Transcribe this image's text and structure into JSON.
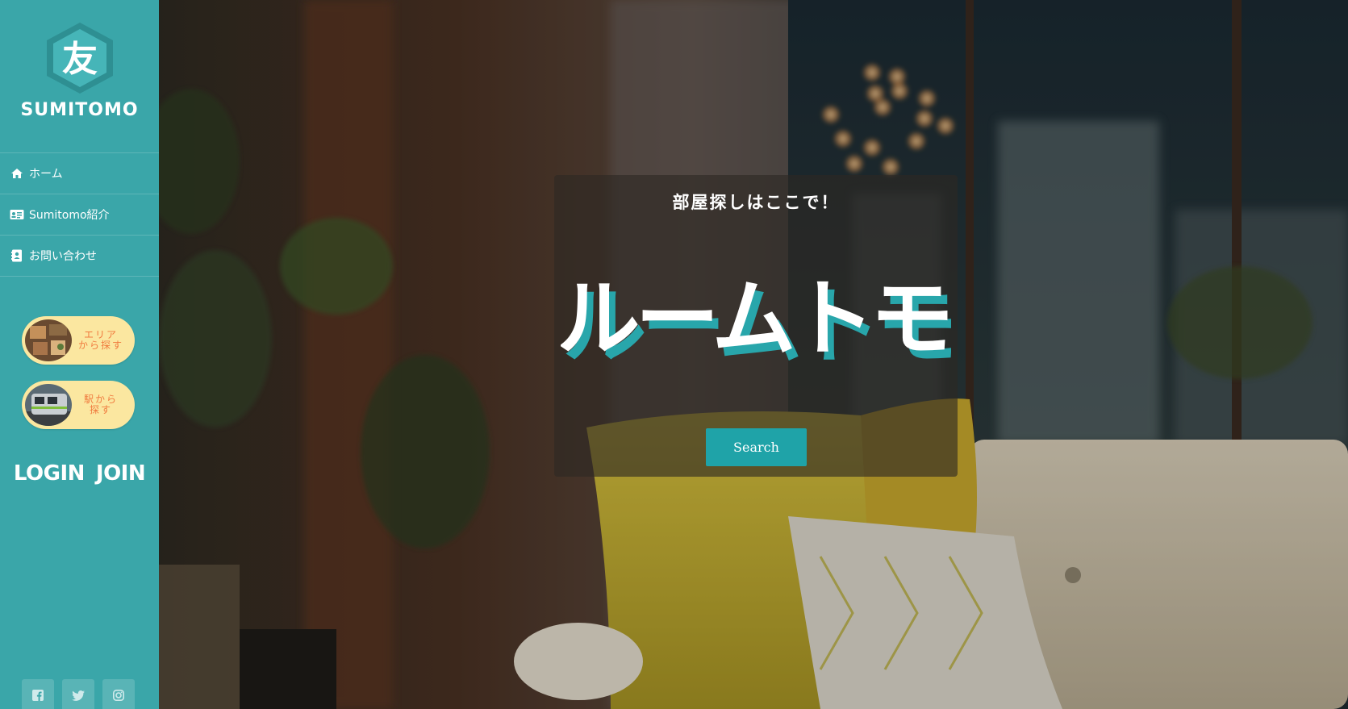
{
  "brand": {
    "name": "SUMITOMO",
    "logo_icon": "kanji-hexagon-logo",
    "colors": {
      "sidebar": "#3aa6a9",
      "accent": "#1fa3a8",
      "pill": "#fbe7a0",
      "pill_text": "#f07b3f"
    }
  },
  "nav": {
    "items": [
      {
        "label": "ホーム",
        "icon": "home-icon"
      },
      {
        "label": "Sumitomo紹介",
        "icon": "id-card-icon"
      },
      {
        "label": "お問い合わせ",
        "icon": "address-book-icon"
      }
    ]
  },
  "quick_links": [
    {
      "label": "エリア\nから探す",
      "thumb": "room-thumbnail"
    },
    {
      "label": "駅から\n探す",
      "thumb": "train-thumbnail"
    }
  ],
  "auth": {
    "login": "LOGIN",
    "join": "JOIN"
  },
  "social": [
    "facebook-icon",
    "twitter-icon",
    "instagram-icon"
  ],
  "hero": {
    "heading": "部屋探しはここで！",
    "logo_text": "ルームトモ",
    "search_label": "Search"
  }
}
